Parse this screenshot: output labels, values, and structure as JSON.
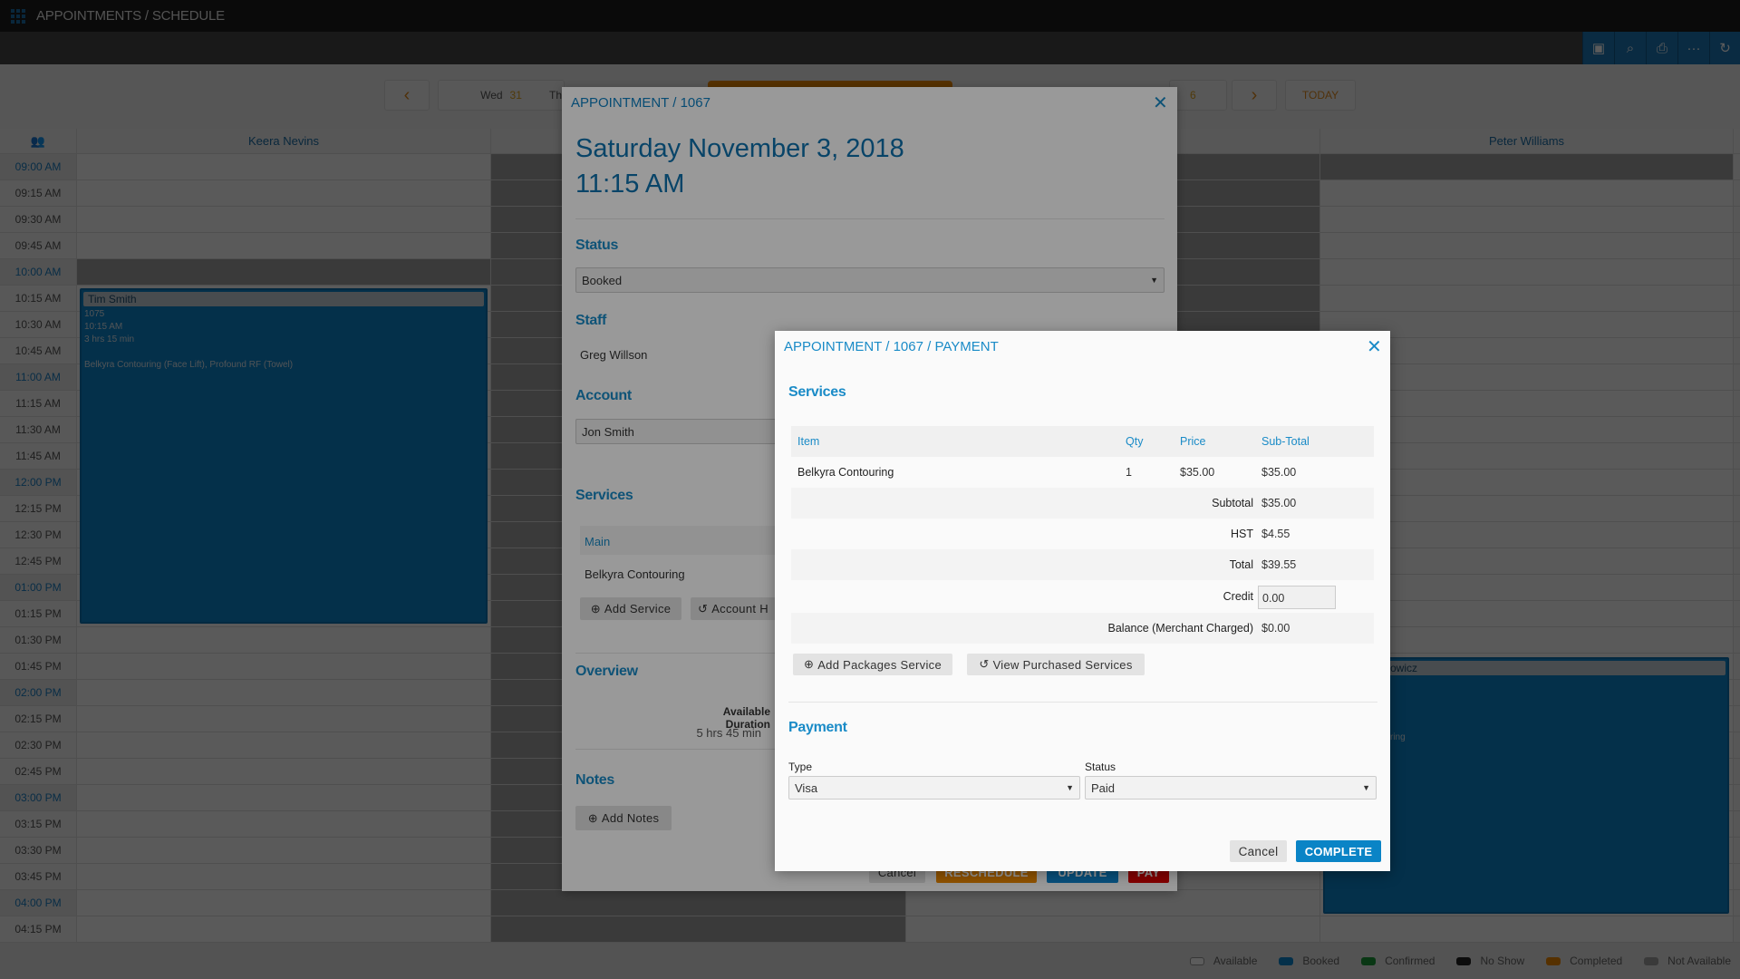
{
  "app": {
    "title": "APPOINTMENTS / SCHEDULE"
  },
  "toolbar": {
    "icons": [
      "calendar-icon",
      "search-icon",
      "print-icon",
      "more-icon",
      "refresh-icon"
    ]
  },
  "nav": {
    "prev": "‹",
    "next": "›",
    "today": "TODAY",
    "days": [
      {
        "label": "Wed",
        "num": "31"
      },
      {
        "label": "Th",
        "num": ""
      },
      {
        "label": "",
        "num": "6"
      }
    ]
  },
  "calendar": {
    "staff": [
      "Keera Nevins",
      "",
      "",
      "Peter Williams"
    ],
    "times": [
      "09:00 AM",
      "09:15 AM",
      "09:30 AM",
      "09:45 AM",
      "10:00 AM",
      "10:15 AM",
      "10:30 AM",
      "10:45 AM",
      "11:00 AM",
      "11:15 AM",
      "11:30 AM",
      "11:45 AM",
      "12:00 PM",
      "12:15 PM",
      "12:30 PM",
      "12:45 PM",
      "01:00 PM",
      "01:15 PM",
      "01:30 PM",
      "01:45 PM",
      "02:00 PM",
      "02:15 PM",
      "02:30 PM",
      "02:45 PM",
      "03:00 PM",
      "03:15 PM",
      "03:30 PM",
      "03:45 PM",
      "04:00 PM",
      "04:15 PM"
    ],
    "appointments": [
      {
        "name": "Tim Smith",
        "id": "1075",
        "time": "10:15 AM",
        "duration": "3 hrs 15 min",
        "services": "Belkyra Contouring (Face Lift), Profound RF (Towel)"
      },
      {
        "name": "owicz",
        "services": "ring"
      }
    ]
  },
  "legend": [
    {
      "label": "Available",
      "color": "#ffffff"
    },
    {
      "label": "Booked",
      "color": "#0e85cf"
    },
    {
      "label": "Confirmed",
      "color": "#1a9a3a"
    },
    {
      "label": "No Show",
      "color": "#222222"
    },
    {
      "label": "Completed",
      "color": "#f08a00"
    },
    {
      "label": "Not Available",
      "color": "#a3a3a3"
    }
  ],
  "appointment_modal": {
    "title": "APPOINTMENT / 1067",
    "date": "Saturday November 3, 2018",
    "time": "11:15 AM",
    "status_label": "Status",
    "status_value": "Booked",
    "staff_label": "Staff",
    "staff_value": "Greg Willson",
    "account_label": "Account",
    "account_value": "Jon Smith",
    "services_label": "Services",
    "services_header": "Main",
    "service_item": "Belkyra Contouring",
    "add_service": "Add Service",
    "account_history": "Account H",
    "overview_label": "Overview",
    "available_duration_label": "Available Duration",
    "available_duration": "5 hrs 45 min",
    "notes_label": "Notes",
    "add_notes": "Add Notes",
    "cancel": "Cancel",
    "reschedule": "RESCHEDULE",
    "update": "UPDATE",
    "pay": "PAY"
  },
  "payment_modal": {
    "title": "APPOINTMENT / 1067 / PAYMENT",
    "services_label": "Services",
    "columns": [
      "Item",
      "Qty",
      "Price",
      "Sub-Total"
    ],
    "rows": [
      {
        "item": "Belkyra Contouring",
        "qty": "1",
        "price": "$35.00",
        "subtotal": "$35.00"
      }
    ],
    "subtotal_label": "Subtotal",
    "subtotal": "$35.00",
    "hst_label": "HST",
    "hst": "$4.55",
    "total_label": "Total",
    "total": "$39.55",
    "credit_label": "Credit",
    "credit": "0.00",
    "balance_label": "Balance (Merchant Charged)",
    "balance": "$0.00",
    "add_packages": "Add Packages Service",
    "view_purchased": "View Purchased Services",
    "payment_label": "Payment",
    "type_label": "Type",
    "type_value": "Visa",
    "status_label": "Status",
    "status_value": "Paid",
    "cancel": "Cancel",
    "complete": "COMPLETE"
  }
}
